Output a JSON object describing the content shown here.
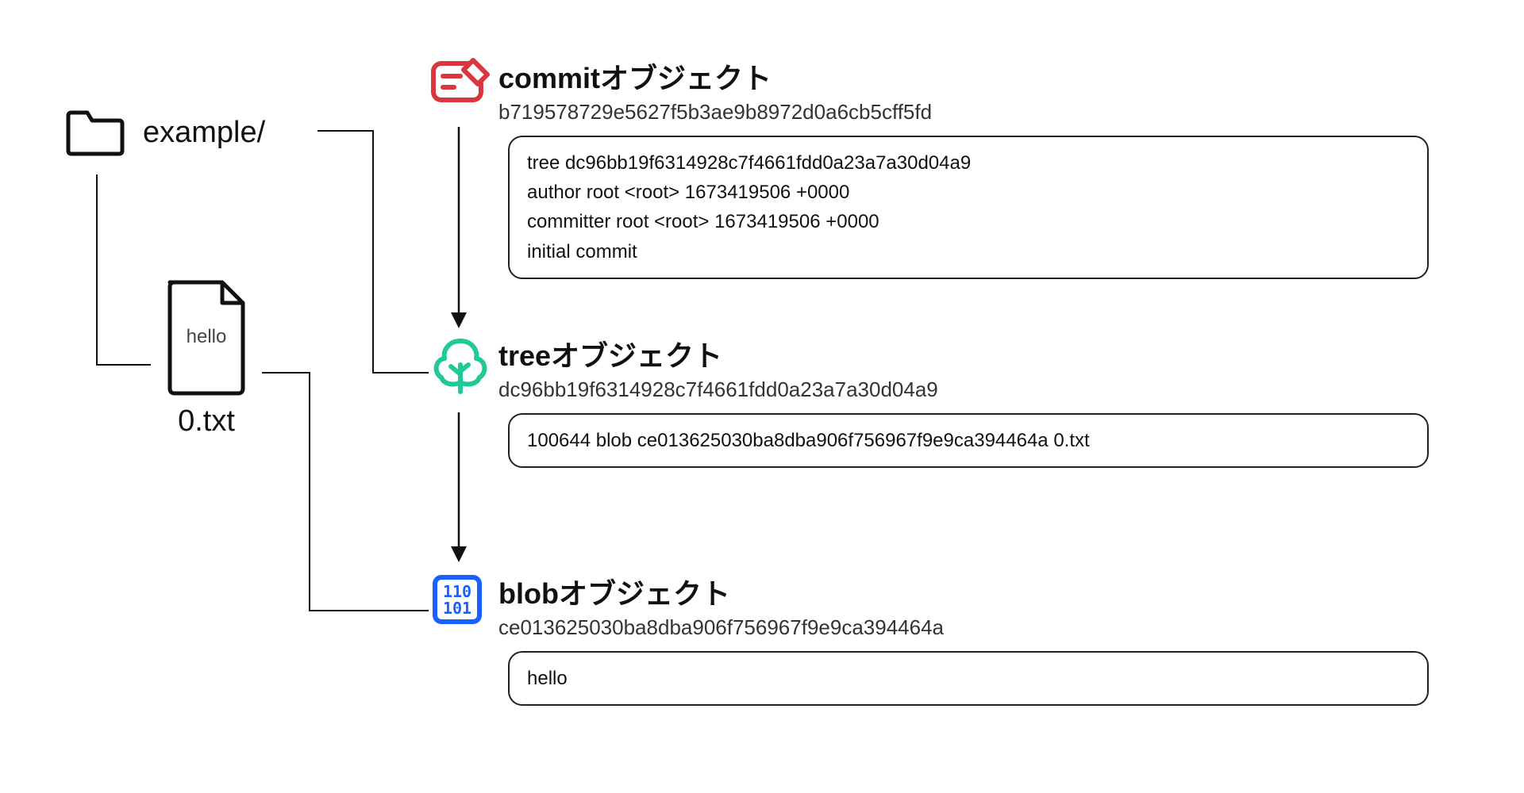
{
  "colors": {
    "commit": "#d9363e",
    "tree": "#20c997",
    "blob": "#1a5fff",
    "line": "#111"
  },
  "fs": {
    "folder_label": "example/",
    "file_label": "0.txt",
    "file_content": "hello"
  },
  "commit": {
    "title": "commitオブジェクト",
    "hash": "b719578729e5627f5b3ae9b8972d0a6cb5cff5fd",
    "body": "tree dc96bb19f6314928c7f4661fdd0a23a7a30d04a9\nauthor root <root> 1673419506 +0000\ncommitter root <root> 1673419506 +0000\ninitial commit"
  },
  "tree": {
    "title": "treeオブジェクト",
    "hash": "dc96bb19f6314928c7f4661fdd0a23a7a30d04a9",
    "body": "100644 blob ce013625030ba8dba906f756967f9e9ca394464a 0.txt"
  },
  "blob": {
    "title": "blobオブジェクト",
    "hash": "ce013625030ba8dba906f756967f9e9ca394464a",
    "body": "hello"
  }
}
